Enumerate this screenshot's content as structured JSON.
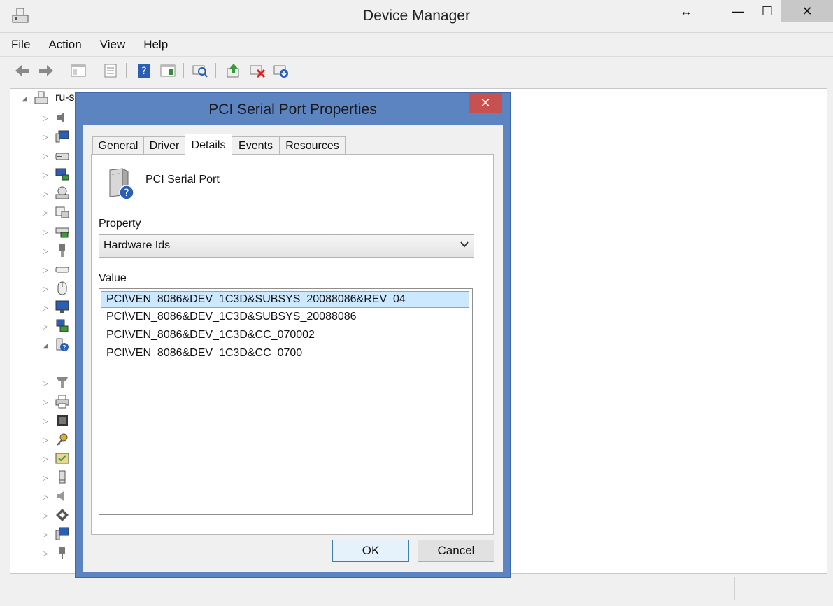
{
  "window": {
    "title": "Device Manager",
    "restore_glyph": "↔",
    "min_glyph": "—",
    "max_glyph": "☐",
    "close_glyph": "✕"
  },
  "menu": [
    "File",
    "Action",
    "View",
    "Help"
  ],
  "toolbar_icons": [
    "back-arrow-icon",
    "forward-arrow-icon",
    "show-hide-console-tree-icon",
    "properties-icon",
    "help-icon",
    "show-hide-action-pane-icon",
    "scan-hardware-changes-icon",
    "update-driver-icon",
    "uninstall-device-icon",
    "disable-device-icon"
  ],
  "tree": {
    "root_label": "ru-s",
    "expand_glyph": "▷",
    "collapse_glyph": "◢"
  },
  "dialog": {
    "title": "PCI Serial Port Properties",
    "close_glyph": "✕",
    "tabs": [
      "General",
      "Driver",
      "Details",
      "Events",
      "Resources"
    ],
    "active_tab": "Details",
    "device_name": "PCI Serial Port",
    "property_label": "Property",
    "property_value": "Hardware Ids",
    "value_label": "Value",
    "values": [
      "PCI\\VEN_8086&DEV_1C3D&SUBSYS_20088086&REV_04",
      "PCI\\VEN_8086&DEV_1C3D&SUBSYS_20088086",
      "PCI\\VEN_8086&DEV_1C3D&CC_070002",
      "PCI\\VEN_8086&DEV_1C3D&CC_0700"
    ],
    "ok_label": "OK",
    "cancel_label": "Cancel"
  },
  "colors": {
    "dialog_frame": "#5b84c1",
    "close_red": "#c75050",
    "selection": "#cce8ff"
  }
}
